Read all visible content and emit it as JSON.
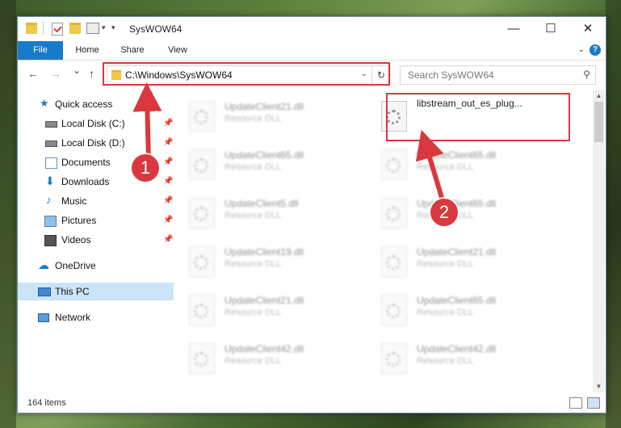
{
  "window": {
    "title": "SysWOW64",
    "minimize": "—",
    "maximize": "☐",
    "close": "✕"
  },
  "ribbon": {
    "tabs": [
      "File",
      "Home",
      "Share",
      "View"
    ],
    "help": "?"
  },
  "nav": {
    "back": "←",
    "forward": "→",
    "recent": "⌄",
    "up": "↑"
  },
  "address": {
    "path": "C:\\Windows\\SysWOW64",
    "chevron": "⌄",
    "refresh": "↻"
  },
  "search": {
    "placeholder": "Search SysWOW64",
    "icon": "⚲"
  },
  "sidebar": {
    "items": [
      {
        "label": "Quick access",
        "icon": "star-icon",
        "pinned": false
      },
      {
        "label": "Local Disk (C:)",
        "icon": "drive-icon",
        "pinned": true
      },
      {
        "label": "Local Disk (D:)",
        "icon": "drive-icon",
        "pinned": true
      },
      {
        "label": "Documents",
        "icon": "documents-icon",
        "pinned": true
      },
      {
        "label": "Downloads",
        "icon": "download-icon",
        "pinned": true
      },
      {
        "label": "Music",
        "icon": "music-icon",
        "pinned": true
      },
      {
        "label": "Pictures",
        "icon": "pictures-icon",
        "pinned": true
      },
      {
        "label": "Videos",
        "icon": "videos-icon",
        "pinned": true
      },
      {
        "label": "OneDrive",
        "icon": "cloud-icon",
        "pinned": false
      },
      {
        "label": "This PC",
        "icon": "computer-icon",
        "pinned": false,
        "selected": true
      },
      {
        "label": "Network",
        "icon": "network-icon",
        "pinned": false
      }
    ],
    "pin_glyph": "📌"
  },
  "files": {
    "left_column": [
      {
        "name": "UpdateClient21.dll",
        "type": "Resource DLL"
      },
      {
        "name": "UpdateClient65.dll",
        "type": "Resource DLL"
      },
      {
        "name": "UpdateClient5.dll",
        "type": "Resource DLL"
      },
      {
        "name": "UpdateClient19.dll",
        "type": "Resource DLL"
      },
      {
        "name": "UpdateClient21.dll",
        "type": "Resource DLL"
      },
      {
        "name": "UpdateClient42.dll",
        "type": "Resource DLL"
      }
    ],
    "right_column": [
      {
        "name": "libstream_out_es_plug...",
        "type": ""
      },
      {
        "name": "UpdateClient65.dll",
        "type": "Resource DLL"
      },
      {
        "name": "UpdateClient65.dll",
        "type": "Resource DLL"
      },
      {
        "name": "UpdateClient21.dll",
        "type": "Resource DLL"
      },
      {
        "name": "UpdateClient65.dll",
        "type": "Resource DLL"
      },
      {
        "name": "UpdateClient42.dll",
        "type": "Resource DLL"
      }
    ]
  },
  "status": {
    "item_count": "164 items"
  },
  "annotations": {
    "badge1": "1",
    "badge2": "2",
    "highlight_color": "#d9383e"
  }
}
